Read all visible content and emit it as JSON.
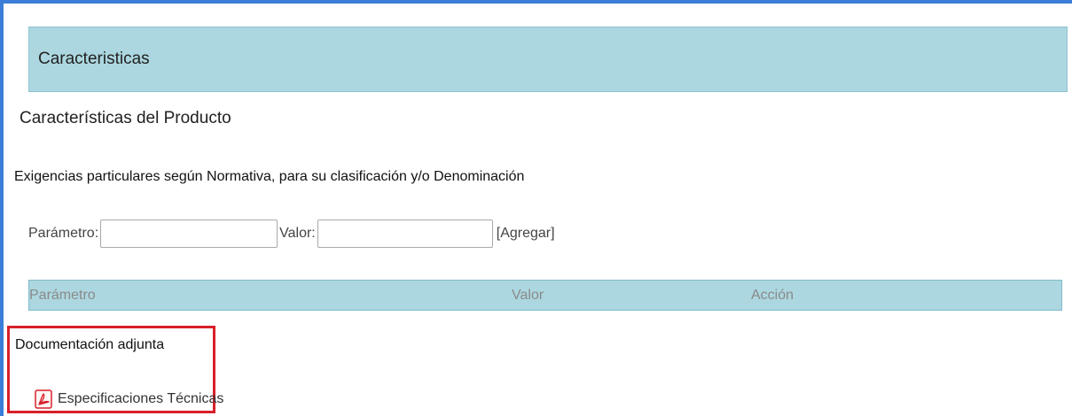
{
  "section": {
    "title": "Caracteristicas"
  },
  "product": {
    "title": "Características del Producto"
  },
  "requirements": {
    "text": "Exigencias particulares según Normativa, para su clasificación y/o Denominación"
  },
  "form": {
    "param_label": "Parámetro:",
    "param_value": "",
    "valor_label": "Valor:",
    "valor_value": "",
    "add_label": "[Agregar]"
  },
  "table": {
    "headers": [
      "Parámetro",
      "Valor",
      "Acción"
    ]
  },
  "documents": {
    "title": "Documentación adjunta",
    "items": [
      {
        "label": "Especificaciones Técnicas",
        "icon": "pdf-icon"
      }
    ]
  },
  "colors": {
    "frame_border": "#3b7dd8",
    "header_bg": "#acd7e0",
    "highlight_border": "#d8202a",
    "pdf_icon": "#d8202a"
  }
}
